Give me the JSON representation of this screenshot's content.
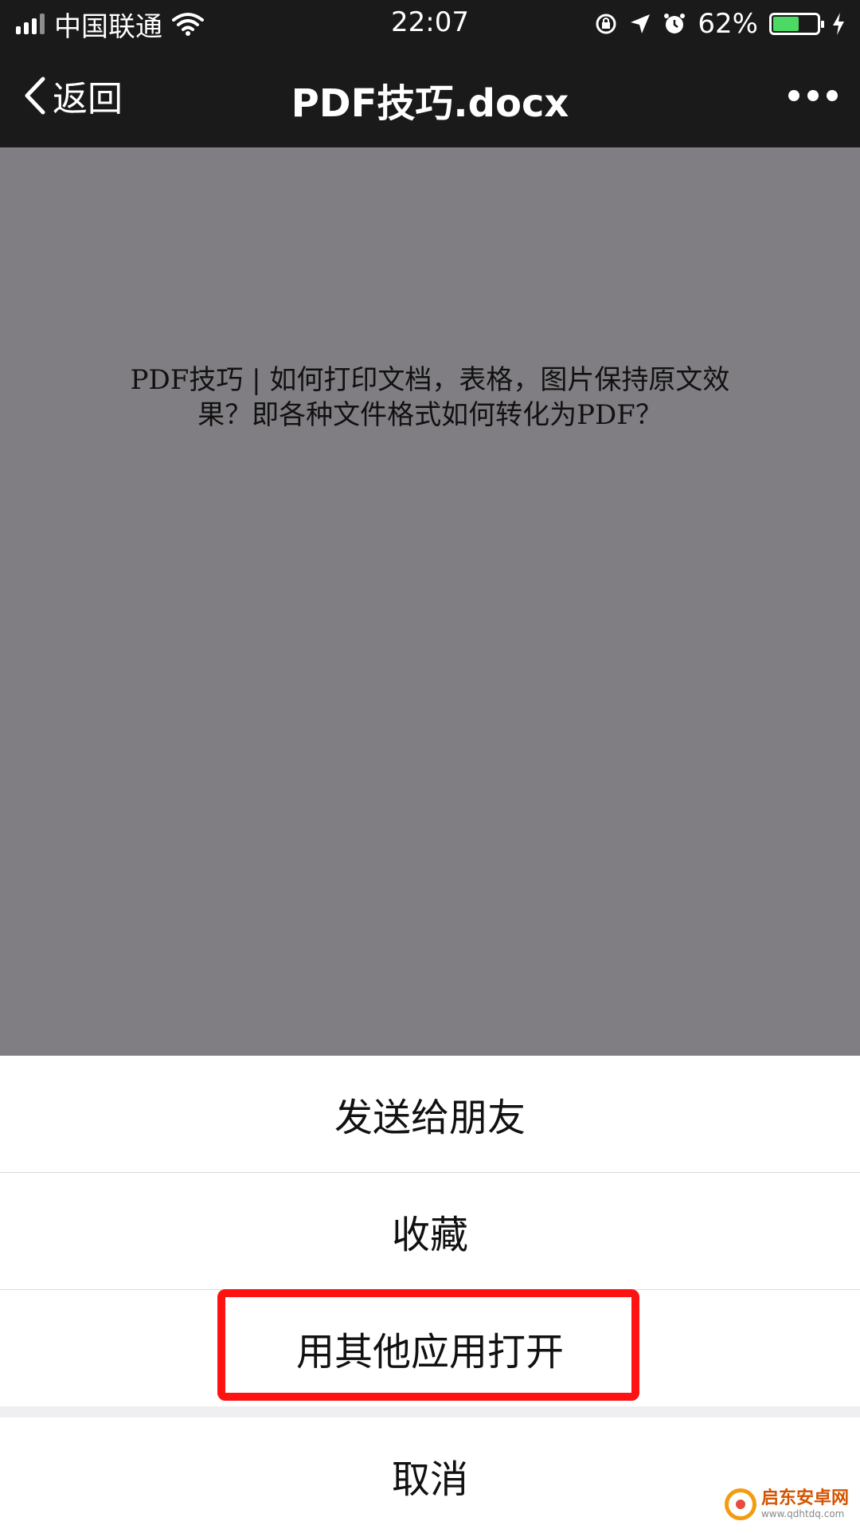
{
  "status_bar": {
    "carrier": "中国联通",
    "time": "22:07",
    "battery": "62%",
    "battery_level": 0.62,
    "icons": [
      "signal-icon",
      "wifi-icon",
      "rotation-lock-icon",
      "location-icon",
      "alarm-icon",
      "battery-icon",
      "charging-icon"
    ]
  },
  "nav": {
    "back_label": "返回",
    "title": "PDF技巧.docx",
    "icons": [
      "chevron-left-icon",
      "more-icon"
    ]
  },
  "document": {
    "title_line1": "PDF技巧 | 如何打印文档，表格，图片保持原文效",
    "title_line2": "果？即各种文件格式如何转化为PDF？"
  },
  "action_sheet": {
    "items": [
      {
        "label": "发送给朋友"
      },
      {
        "label": "收藏"
      },
      {
        "label": "用其他应用打开"
      }
    ],
    "cancel_label": "取消"
  },
  "watermark": {
    "name": "启东安卓网",
    "url": "www.qdhtdq.com"
  },
  "colors": {
    "bar_bg": "#1a1a1a",
    "preview_bg": "#807e82",
    "highlight": "#ff1212",
    "battery_fill": "#4cd964"
  }
}
